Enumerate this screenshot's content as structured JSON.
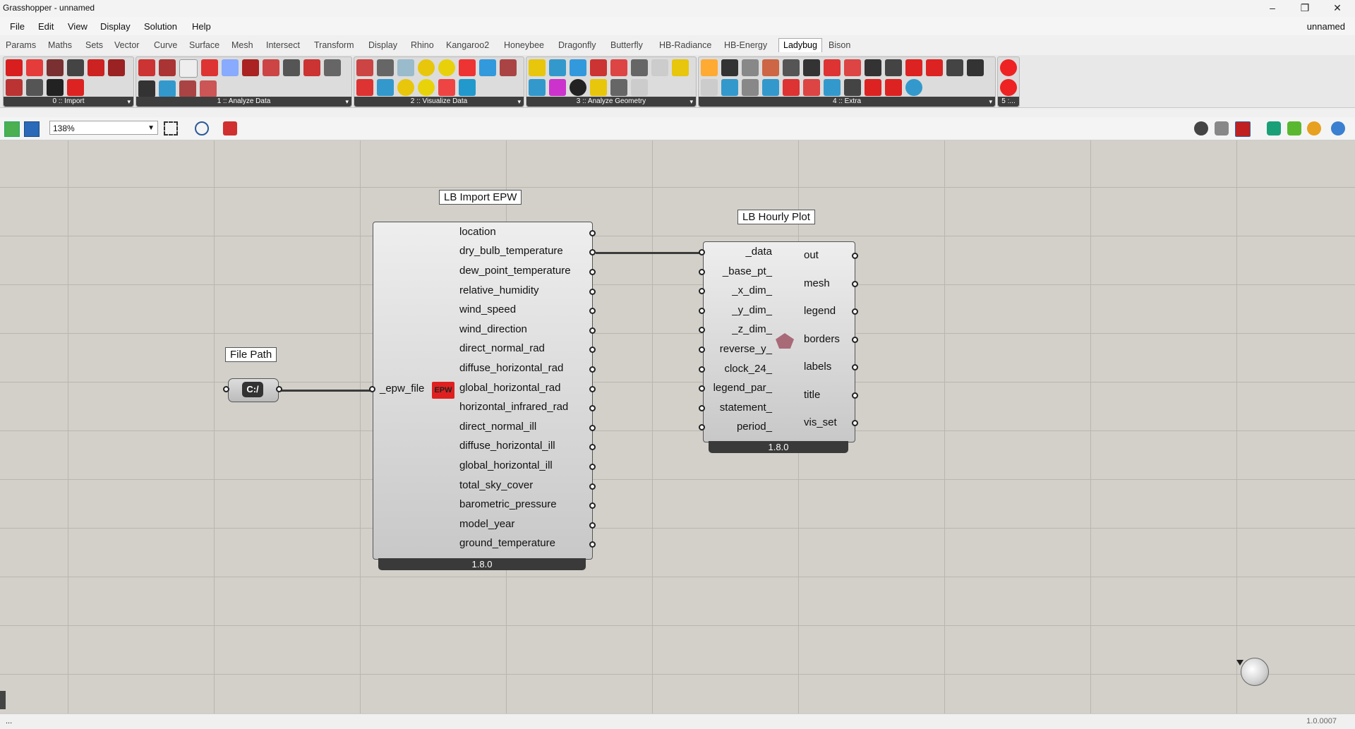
{
  "window": {
    "title": "Grasshopper - unnamed",
    "doc_name": "unnamed",
    "minimize": "–",
    "restore": "❐",
    "close": "✕"
  },
  "menu": [
    "File",
    "Edit",
    "View",
    "Display",
    "Solution",
    "Help"
  ],
  "tabs": [
    "Params",
    "Maths",
    "Sets",
    "Vector",
    "Curve",
    "Surface",
    "Mesh",
    "Intersect",
    "Transform",
    "Display",
    "Rhino",
    "Kangaroo2",
    "Honeybee",
    "Dragonfly",
    "Butterfly",
    "HB-Radiance",
    "HB-Energy",
    "Ladybug",
    "Bison"
  ],
  "active_tab": "Ladybug",
  "ribbon_panels": [
    "0 :: Import",
    "1 :: Analyze Data",
    "2 :: Visualize Data",
    "3 :: Analyze Geometry",
    "4 :: Extra",
    "5 :..."
  ],
  "zoom": "138%",
  "components": {
    "file_path": {
      "label": "File Path",
      "glyph": "C:/"
    },
    "import_epw": {
      "label": "LB Import EPW",
      "input": "_epw_file",
      "badge": "EPW",
      "outputs": [
        "location",
        "dry_bulb_temperature",
        "dew_point_temperature",
        "relative_humidity",
        "wind_speed",
        "wind_direction",
        "direct_normal_rad",
        "diffuse_horizontal_rad",
        "global_horizontal_rad",
        "horizontal_infrared_rad",
        "direct_normal_ill",
        "diffuse_horizontal_ill",
        "global_horizontal_ill",
        "total_sky_cover",
        "barometric_pressure",
        "model_year",
        "ground_temperature"
      ],
      "version": "1.8.0"
    },
    "hourly_plot": {
      "label": "LB Hourly Plot",
      "inputs": [
        "_data",
        "_base_pt_",
        "_x_dim_",
        "_y_dim_",
        "_z_dim_",
        "reverse_y_",
        "clock_24_",
        "legend_par_",
        "statement_",
        "period_"
      ],
      "outputs": [
        "out",
        "mesh",
        "legend",
        "borders",
        "labels",
        "title",
        "vis_set"
      ],
      "version": "1.8.0"
    }
  },
  "status": {
    "left": "...",
    "version": "1.0.0007"
  }
}
